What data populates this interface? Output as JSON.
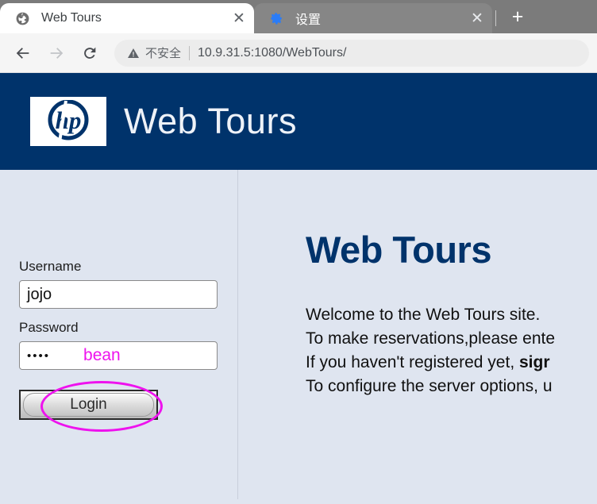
{
  "browser": {
    "tabs": [
      {
        "title": "Web Tours",
        "favicon": "globe-icon",
        "close_label": "✕",
        "active": true
      },
      {
        "title": "设置",
        "favicon": "gear-icon",
        "close_label": "✕",
        "active": false
      }
    ],
    "new_tab_label": "+",
    "toolbar": {
      "back_label": "←",
      "forward_label": "→",
      "reload_label": "⟳"
    },
    "omnibox": {
      "security_text": "不安全",
      "separator": "|",
      "url": "10.9.31.5:1080/WebTours/"
    }
  },
  "page": {
    "banner": {
      "logo_text": "hp",
      "title": "Web Tours",
      "background_color": "#00336b"
    },
    "login": {
      "username_label": "Username",
      "username_value": "jojo",
      "password_label": "Password",
      "password_masked": "••••",
      "password_annotation": "bean",
      "login_button_label": "Login",
      "annotation_color": "#ee12ee"
    },
    "content": {
      "heading": "Web Tours",
      "line1": "Welcome to the Web Tours site.",
      "line2": "To make reservations,please ente",
      "line3_prefix": "If you haven't registered yet, ",
      "line3_bold": "sigr",
      "line4": "To configure the server options, u"
    }
  }
}
